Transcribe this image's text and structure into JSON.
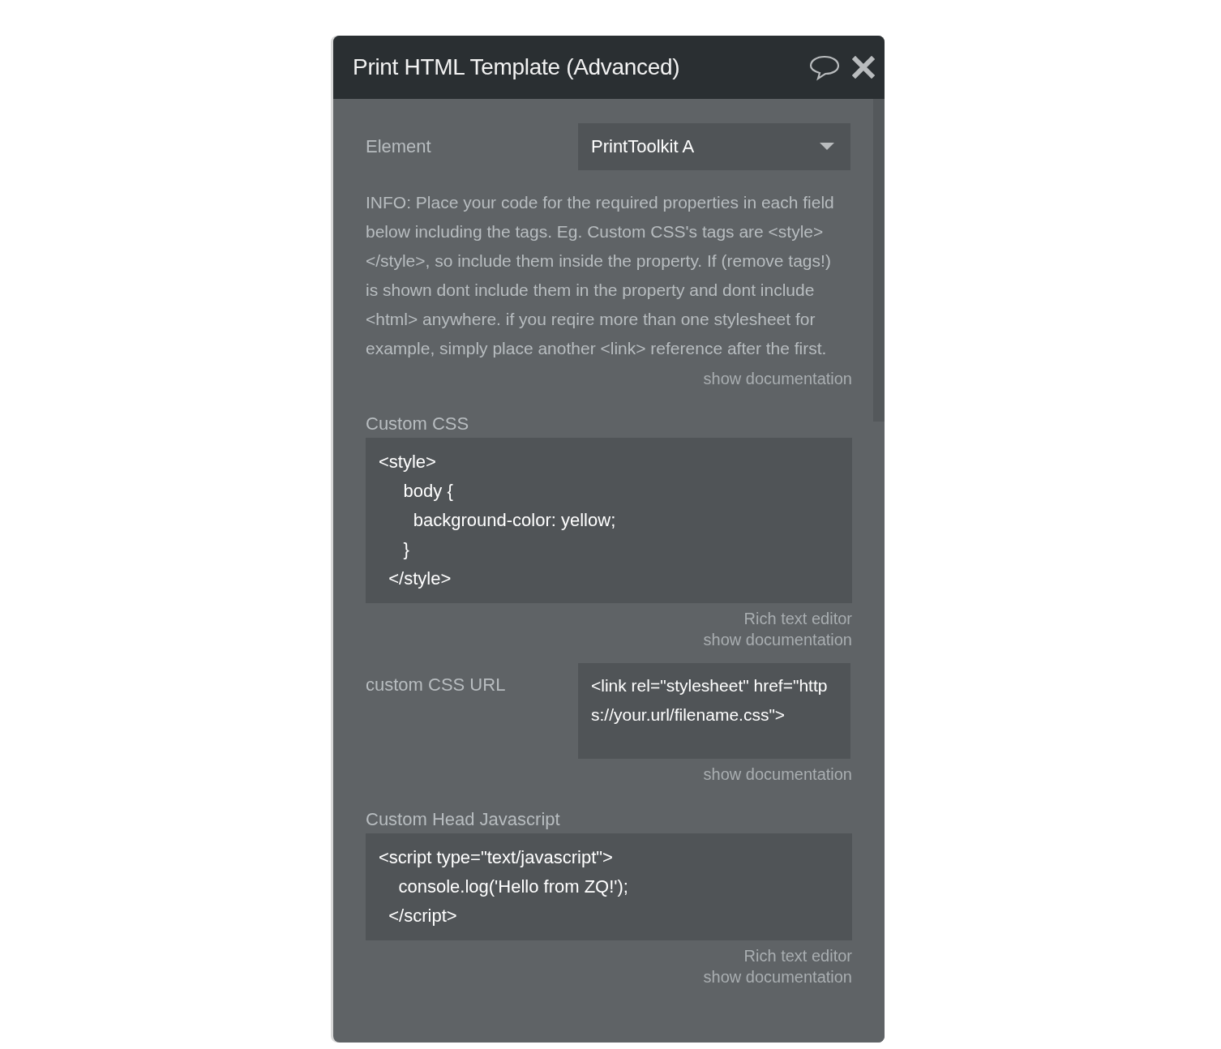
{
  "window": {
    "title": "Print HTML Template (Advanced)"
  },
  "sections": [
    {
      "kind": "dropdown",
      "label": "Element",
      "value": "PrintToolkit A"
    },
    {
      "kind": "info",
      "text": "INFO: Place your code for the required properties in each field below including the tags. Eg. Custom CSS's tags are <style></style>, so include them inside the property. If (remove tags!) is shown dont include them in the property and dont include <html> anywhere. if you reqire more than one stylesheet for example, simply place another <link> reference after the first.",
      "links": [
        "show documentation"
      ]
    },
    {
      "kind": "code",
      "label": "Custom CSS",
      "lines": [
        "<style>",
        "     body {",
        "       background-color: yellow;",
        "     }",
        "  </style>"
      ],
      "links": [
        "Rich text editor",
        "show documentation"
      ]
    },
    {
      "kind": "inline",
      "label": "custom CSS URL",
      "value": "<link rel=\"stylesheet\" href=\"https://your.url/filename.css\">",
      "links": [
        "show documentation"
      ]
    },
    {
      "kind": "code",
      "label": "Custom Head Javascript",
      "lines": [
        "<script type=\"text/javascript\">",
        "    console.log('Hello from ZQ!');",
        "  </script>"
      ],
      "links": [
        "Rich text editor",
        "show documentation"
      ]
    }
  ]
}
